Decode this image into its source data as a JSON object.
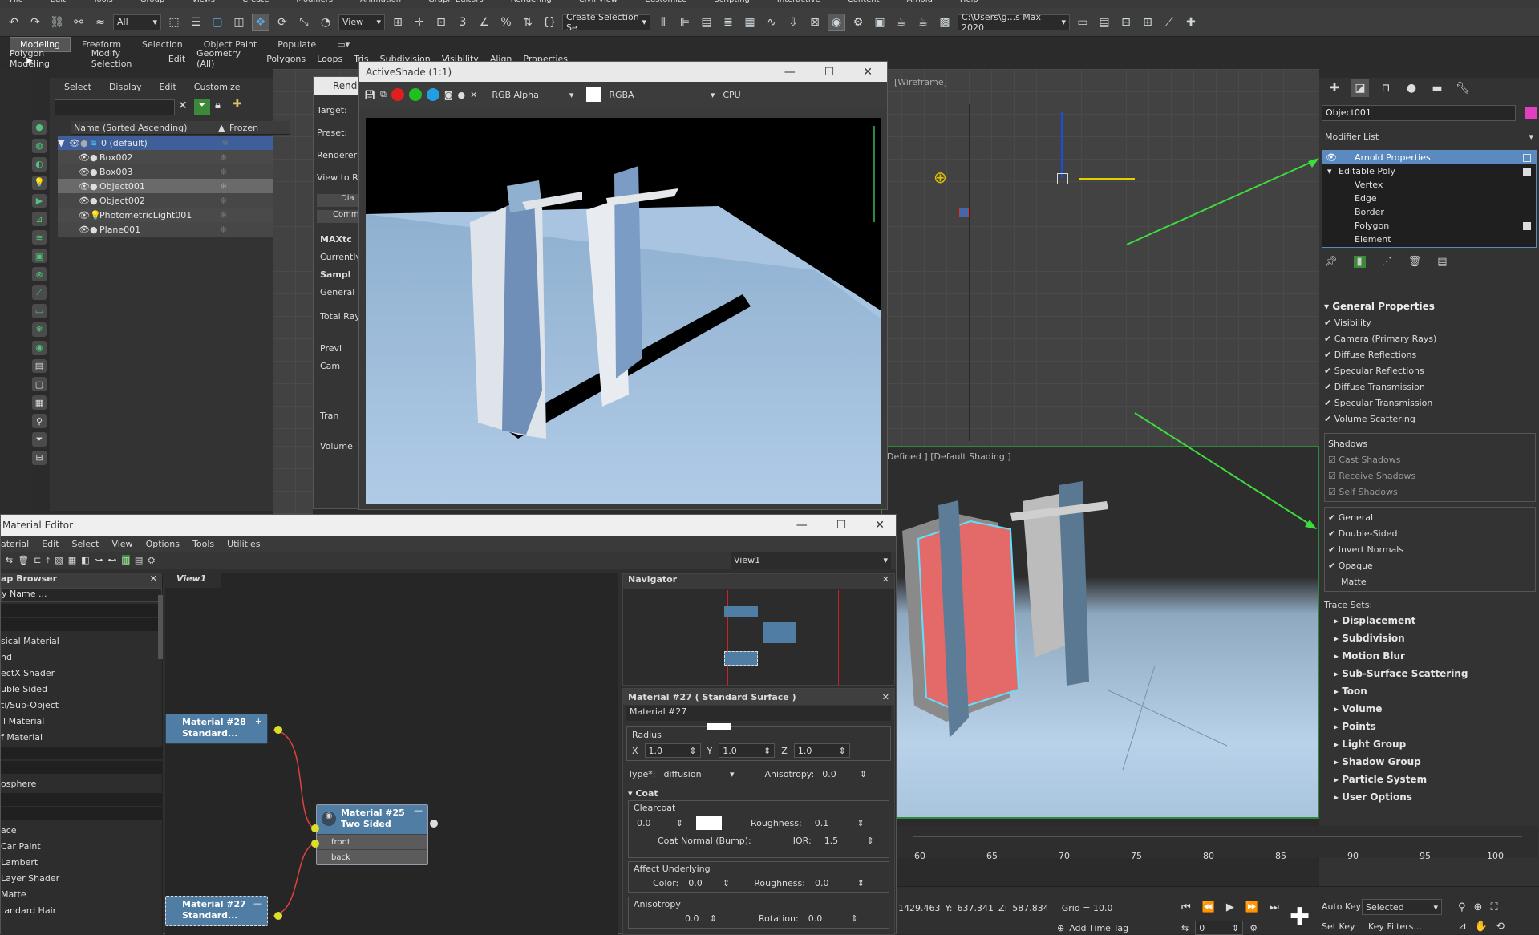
{
  "toolbar": {
    "selection_filter": "All",
    "ref_coord": "View",
    "named_selection": "Create Selection Se",
    "project_path": "C:\\Users\\g...s Max 2020"
  },
  "ribbon": {
    "tabs": [
      "Modeling",
      "Freeform",
      "Selection",
      "Object Paint",
      "Populate"
    ],
    "sub": [
      "Polygon Modeling",
      "Modify Selection",
      "Edit",
      "Geometry (All)",
      "Polygons",
      "Loops",
      "Tris",
      "Subdivision",
      "Visibility",
      "Align",
      "Properties"
    ]
  },
  "scene_explorer": {
    "menu": [
      "Select",
      "Display",
      "Edit",
      "Customize"
    ],
    "col_name": "Name (Sorted Ascending)",
    "col_frozen": "Frozen",
    "layer": "0 (default)",
    "items": [
      "Box002",
      "Box003",
      "Object001",
      "Object002",
      "PhotometricLight001",
      "Plane001"
    ]
  },
  "render_setup": {
    "title": "Rende",
    "labels": [
      "Target:",
      "Preset:",
      "Renderer:",
      "View to Re"
    ],
    "tabs": [
      "Dia",
      "Comm"
    ],
    "sections": [
      "MAXtc",
      "Currently",
      "Sampl",
      "General",
      "Total Ray",
      "Previ",
      "Cam",
      "Tran",
      "Volume"
    ]
  },
  "activeshade": {
    "title": "ActiveShade (1:1)",
    "channel": "RGB Alpha",
    "format": "RGBA",
    "device": "CPU"
  },
  "viewports": {
    "top_label": "[Wireframe]",
    "bottom_label": "r Defined ] [Default Shading ]"
  },
  "material_editor": {
    "title": "Material Editor",
    "menu": [
      "aterial",
      "Edit",
      "Select",
      "View",
      "Options",
      "Tools",
      "Utilities"
    ],
    "view_combo": "View1",
    "map_browser_title": "ap Browser",
    "map_search": "y Name ...",
    "map_items_1": [
      "sical Material",
      "nd",
      "ectX Shader",
      "uble Sided",
      "ti/Sub-Object",
      "ll Material",
      "f Material"
    ],
    "map_items_2": [
      "osphere"
    ],
    "map_items_3": [
      "ace",
      "Car Paint",
      "Lambert",
      "Layer Shader",
      "Matte",
      "tandard Hair"
    ],
    "view_tab": "View1",
    "nodes": {
      "n28": {
        "title1": "Material #28",
        "title2": "Standard..."
      },
      "n25": {
        "title1": "Material #25",
        "title2": "Two Sided",
        "slot1": "front",
        "slot2": "back"
      },
      "n27": {
        "title1": "Material #27",
        "title2": "Standard..."
      }
    },
    "navigator_title": "Navigator",
    "params": {
      "title": "Material #27  ( Standard Surface )",
      "name": "Material #27",
      "radius_label": "Radius",
      "radius": {
        "x": "1.0",
        "y": "1.0",
        "z": "1.0"
      },
      "type_label": "Type*:",
      "type_value": "diffusion",
      "aniso_label": "Anisotropy:",
      "aniso_value": "0.0",
      "coat_title": "Coat",
      "clearcoat_label": "Clearcoat",
      "clearcoat_value": "0.0",
      "roughness_label": "Roughness:",
      "roughness_value": "0.1",
      "coat_normal_label": "Coat Normal (Bump):",
      "ior_label": "IOR:",
      "ior_value": "1.5",
      "affect_label": "Affect Underlying",
      "color_label": "Color:",
      "color_value": "0.0",
      "aff_rough_label": "Roughness:",
      "aff_rough_value": "0.0",
      "anisotropy_label": "Anisotropy",
      "aniso2_value": "0.0",
      "rotation_label": "Rotation:",
      "rotation_value": "0.0"
    }
  },
  "command_panel": {
    "object_name": "Object001",
    "modifier_list": "Modifier List",
    "stack": [
      "Arnold Properties",
      "Editable Poly",
      "Vertex",
      "Edge",
      "Border",
      "Polygon",
      "Element"
    ],
    "general_title": "General Properties",
    "visibility": [
      "Visibility",
      "Camera (Primary Rays)",
      "Diffuse Reflections",
      "Specular Reflections",
      "Diffuse Transmission",
      "Specular Transmission",
      "Volume Scattering"
    ],
    "shadows_title": "Shadows",
    "shadows": [
      "Cast Shadows",
      "Receive Shadows",
      "Self Shadows"
    ],
    "general2_title": "General",
    "general2": [
      "Double-Sided",
      "Invert Normals",
      "Opaque",
      "Matte"
    ],
    "trace_sets": "Trace Sets:",
    "rollouts": [
      "Displacement",
      "Subdivision",
      "Motion Blur",
      "Sub-Surface Scattering",
      "Toon",
      "Volume",
      "Points",
      "Light Group",
      "Shadow Group",
      "Particle System",
      "User Options"
    ]
  },
  "timeline": {
    "ticks": [
      "60",
      "65",
      "70",
      "75",
      "80",
      "85",
      "90",
      "95",
      "100"
    ]
  },
  "status": {
    "x": "1429.463",
    "y_label": "Y:",
    "y": "637.341",
    "z_label": "Z:",
    "z": "587.834",
    "grid": "Grid = 10.0",
    "add_time_tag": "Add Time Tag",
    "auto_key": "Auto Key",
    "selected": "Selected",
    "set_key": "Set Key",
    "key_filters": "Key Filters...",
    "frame": "0"
  },
  "colors": {
    "accent_green": "#3ddc3d",
    "selection_blue": "#5a8ac0",
    "node_yellow": "#d8e02a"
  }
}
